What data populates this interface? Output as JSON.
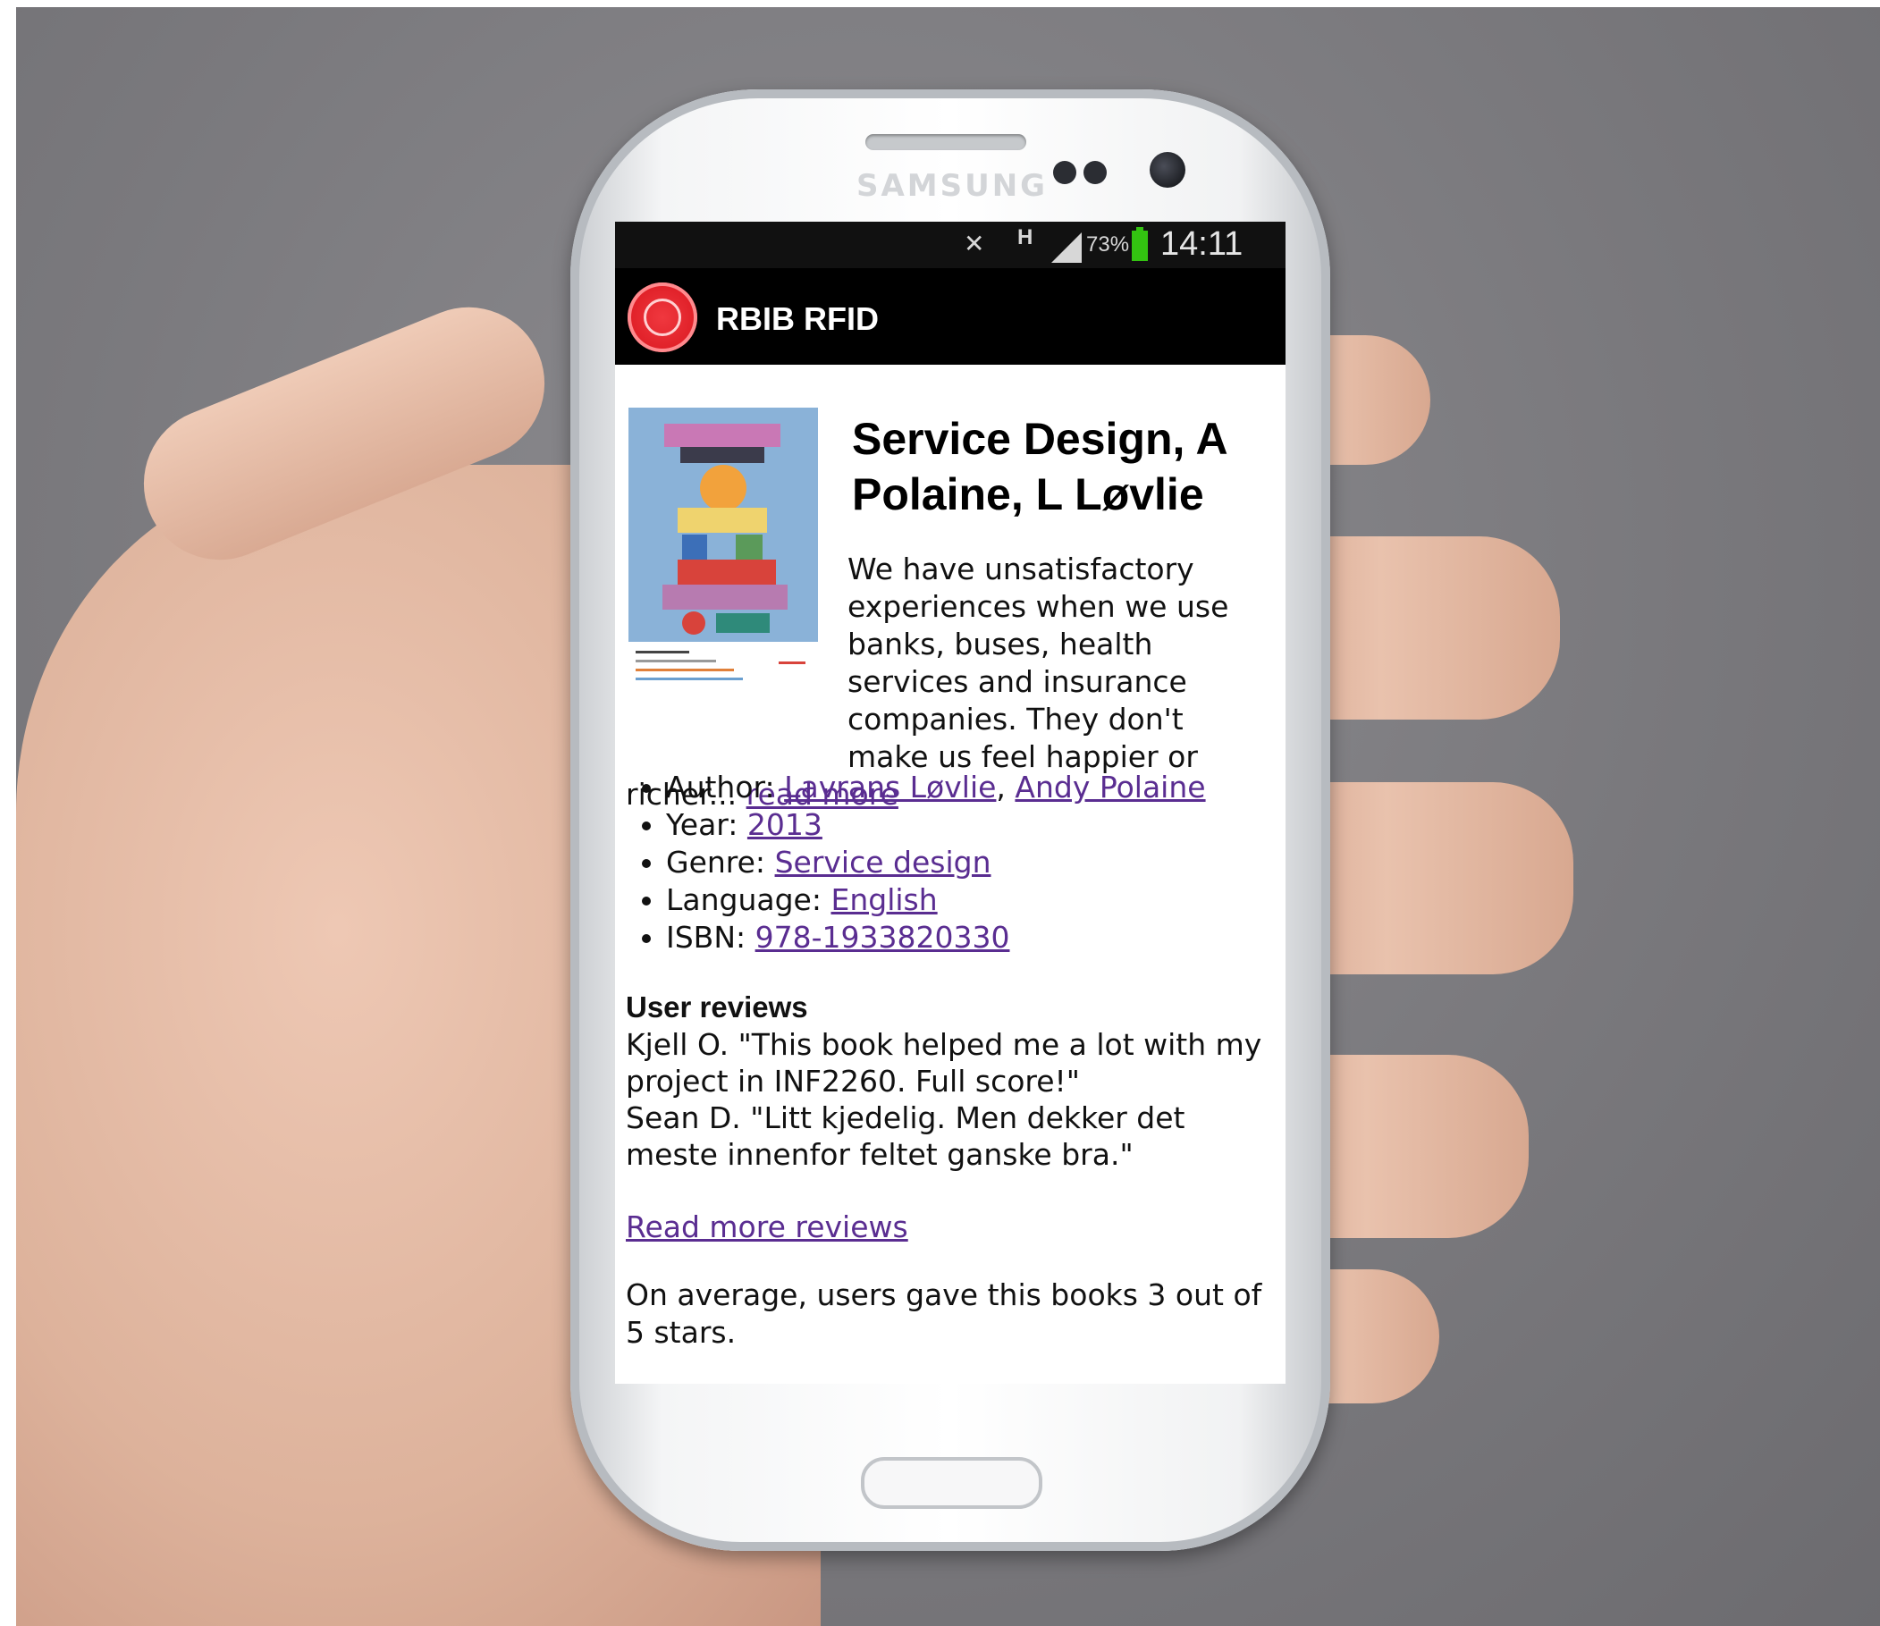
{
  "phone": {
    "brand": "SAMSUNG"
  },
  "status_bar": {
    "mute_icon": "vibrate-mute-icon",
    "network_type": "H",
    "battery_percent": "73%",
    "time": "14:11"
  },
  "app": {
    "title": "RBIB RFID",
    "logo_icon": "university-seal-icon"
  },
  "book": {
    "title_line1": "Service Design, A",
    "title_line2": "Polaine, L Løvlie",
    "description": "We have unsatisfactory experiences when we use banks, buses, health services and insurance companies. They don't make us feel happier or richer...",
    "read_more": "read more",
    "details": {
      "author_label": "Author:",
      "author_1": "Lavrans Løvlie",
      "author_separator": ",",
      "author_2": "Andy Polaine",
      "year_label": "Year:",
      "year": "2013",
      "genre_label": "Genre:",
      "genre": "Service design",
      "language_label": "Language:",
      "language": "English",
      "isbn_label": "ISBN:",
      "isbn": "978-1933820330"
    }
  },
  "reviews": {
    "heading": "User reviews",
    "items": [
      {
        "author": "Kjell O.",
        "text": "\"This book helped me a lot with my project in INF2260. Full score!\""
      },
      {
        "author": "Sean D.",
        "text": "\"Litt kjedelig. Men dekker det meste innenfor feltet ganske bra.\""
      }
    ],
    "read_more_reviews": "Read more reviews",
    "average_text": "On average, users gave this books 3 out of 5 stars."
  },
  "colors": {
    "link": "#5a2d91",
    "status_bar_bg": "#111111",
    "action_bar_bg": "#000000",
    "logo_red": "#df1f27",
    "battery_green": "#33c311"
  }
}
